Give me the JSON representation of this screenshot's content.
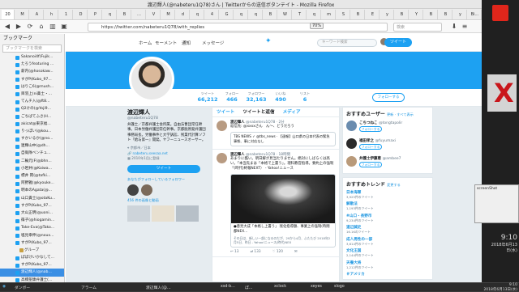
{
  "window": {
    "title": "渡辺輝人(@nabeteru1Q78)さん | Twitterからの送信ボタンテイト - Mozilla Firefox"
  },
  "tabs": [
    "20",
    "M",
    "A",
    "h",
    "1",
    "D",
    "P",
    "q",
    "B",
    "…",
    "V",
    "M",
    "d",
    "q",
    "4",
    "G",
    "q",
    "q",
    "B",
    "W",
    "T",
    "q",
    "m",
    "S",
    "B",
    "E",
    "y",
    "B",
    "Y",
    "B",
    "B",
    "y",
    "Bi…"
  ],
  "urlbar": {
    "url": "https://twitter.com/nabeteru1Q78/with_replies",
    "zoom": "70%",
    "search_placeholder": "検索"
  },
  "sidebar": {
    "title": "ブックマーク",
    "search_placeholder": "ブックマークを検索",
    "items": [
      {
        "label": "Sakanoi4f(Fujik...",
        "type": "bookmark",
        "selected": false
      },
      {
        "label": "たろうfeaturing ...",
        "type": "bookmark",
        "selected": false
      },
      {
        "label": "薪内(@hosokaw...",
        "type": "bookmark",
        "selected": false
      },
      {
        "label": "すがP(Kubo_97...",
        "type": "bookmark",
        "selected": false
      },
      {
        "label": "はりこ6(@mush...",
        "type": "bookmark",
        "selected": false
      },
      {
        "label": "目羽上(ni薬士・...",
        "type": "bookmark",
        "selected": false
      },
      {
        "label": "てんチ入(@ft8...",
        "type": "bookmark",
        "selected": false
      },
      {
        "label": "Q2けの(@Yoji9...",
        "type": "bookmark",
        "selected": false
      },
      {
        "label": "ごちばてふさ(H...",
        "type": "bookmark",
        "selected": false
      },
      {
        "label": "akicat@東京福...",
        "type": "bookmark",
        "selected": false
      },
      {
        "label": "りっぽい(@kou...",
        "type": "bookmark",
        "selected": false
      },
      {
        "label": "すかいるか(@no...",
        "type": "bookmark",
        "selected": false
      },
      {
        "label": "連輝山中(@dh...",
        "type": "bookmark",
        "selected": false
      },
      {
        "label": "自衛隊ベンチュ...",
        "type": "bookmark",
        "selected": false
      },
      {
        "label": "二輪元(F(@bhn...",
        "type": "bookmark",
        "selected": false
      },
      {
        "label": "小岩井(@Koiwa...",
        "type": "bookmark",
        "selected": false
      },
      {
        "label": "標井 岡(@tafki...",
        "type": "bookmark",
        "selected": false
      },
      {
        "label": "阿野雅(@kyouke...",
        "type": "bookmark",
        "selected": false
      },
      {
        "label": "明本のAgata(@...",
        "type": "bookmark",
        "selected": false
      },
      {
        "label": "山口貴士(@otaKu...",
        "type": "bookmark",
        "selected": false
      },
      {
        "label": "すがP(Kubo_97...",
        "type": "bookmark",
        "selected": false
      },
      {
        "label": "大山正明(@uoni...",
        "type": "bookmark",
        "selected": false
      },
      {
        "label": "篠子(@hiogamin...",
        "type": "bookmark",
        "selected": false
      },
      {
        "label": "Take-Eva(@Tako...",
        "type": "bookmark",
        "selected": false
      },
      {
        "label": "塩見幸伸(@noux...",
        "type": "bookmark",
        "selected": false
      },
      {
        "label": "すがP(Kubo_97...",
        "type": "bookmark",
        "selected": false
      },
      {
        "label": "グループ",
        "type": "folder",
        "selected": false
      },
      {
        "label": "ぱぱけいかなして...",
        "type": "bookmark",
        "selected": false
      },
      {
        "label": "すがP(Kubo_97...",
        "type": "bookmark",
        "selected": false
      },
      {
        "label": "渡辺輝人(@nab...",
        "type": "bookmark",
        "selected": true
      },
      {
        "label": "高橋聖康弁護士(...",
        "type": "bookmark",
        "selected": false
      },
      {
        "label": "寺町東子(@tokot...",
        "type": "bookmark",
        "selected": false
      }
    ]
  },
  "twitter_nav": {
    "home": "ホーム",
    "moments": "モーメント",
    "notifications": "通知",
    "messages": "メッセージ",
    "search_placeholder": "キーワード検索",
    "tweet_button": "ツイート"
  },
  "stats": [
    {
      "label": "ツイート",
      "value": "66,212"
    },
    {
      "label": "フォロー",
      "value": "466"
    },
    {
      "label": "フォロワー",
      "value": "32,163"
    },
    {
      "label": "いいね",
      "value": "490"
    },
    {
      "label": "リスト",
      "value": "6"
    }
  ],
  "follow_button": "フォローする",
  "profile": {
    "name": "渡辺輝人",
    "handle": "@nabeteru1Q78",
    "bio": "弁護士／京都弁護士会所属。自由法曹団常任幹事。日本労働弁護団常任幹事。京都脱原発弁護団事務局長。労働事件と大学訴訟、残業代計算ソフト『給与第一』開発。ヤフーニュースオーサー。",
    "location": "京都市／日本",
    "link": "nabeteru.seesaa.net",
    "joined": "2010年1月に登録",
    "tweet_to": "ツイート",
    "followers_known": "あなたがフォローしているフォロワー",
    "media": "456 件の画像と動画"
  },
  "timeline": {
    "tabs": [
      "ツイート",
      "ツイートと返信",
      "メディア"
    ],
    "tweets": [
      {
        "name": "渡辺輝人",
        "handle": "@nabeteru1Q78 · 2分",
        "text": "返信先: @xxxxさん　ん～、どうだろう",
        "quote": "TBS NEWS ✓ @tbs_news · 【速報】山口県の日本代表の緊急事態、事に対応なし"
      },
      {
        "name": "渡辺輝人",
        "handle": "@nabeteru1Q78 · 18時間",
        "text": "あまりに酷い。明日解が見当たりません。絶対にしばらくは高い。「本当先まは「本格で上書う」。理科教官指導。要約上の強制「(時代)終報NEXT） - Yahoo!ニュース",
        "card_title": "●意見大成「本格し上書う」 残化指導額、事業上の強制(時間都NEX...",
        "card_snippet": "その日は、新しい一部になるのだが、29から4月、ふたたび 2018年2月5日、昨日 - Yahoo!ニュース(時代)NEX"
      }
    ],
    "actions": {
      "reply": "13",
      "retweet": "133",
      "like": "120"
    }
  },
  "suggestions": {
    "title": "おすすめユーザー",
    "refresh": "更新 · すべて表示",
    "users": [
      {
        "name": "こちつねこ",
        "handle": "@tongtapolir",
        "button": "フォローする"
      },
      {
        "name": "福田孝之",
        "handle": "@fuyumaxi",
        "button": "フォローする"
      },
      {
        "name": "弁護士伊藤恵",
        "handle": "@ambee7",
        "button": "フォローする"
      }
    ]
  },
  "trends": {
    "title": "おすすめトレンド",
    "change": "変更する",
    "items": [
      {
        "name": "日本海軍",
        "count": "3,925件のツイート"
      },
      {
        "name": "解散法",
        "count": "1,193件のツイート"
      },
      {
        "name": "#山口・長野市",
        "count": "9,234件のツイート"
      },
      {
        "name": "道辺誠史",
        "count": "16.1Kのツイート"
      },
      {
        "name": "成人男性の一部",
        "count": "3,614件のツイート"
      },
      {
        "name": "文化王国",
        "count": "2,144件のツイート"
      },
      {
        "name": "天養大将",
        "count": "1,212件のツイート"
      },
      {
        "name": "＃アメリカ",
        "count": ""
      }
    ]
  },
  "desktop": {
    "screenshot_window": "screenShot",
    "clock_time": "9:10",
    "clock_date": "2018年6月13日(水)"
  },
  "taskbar": {
    "items": [
      "ダンボー",
      "アラーム",
      "渡辺輝人(@…",
      "xsd-b…",
      "ぽ…",
      "xclock",
      "xeyes",
      "slogo"
    ],
    "time": "9:10",
    "date": "2018年6月13日(水)"
  }
}
